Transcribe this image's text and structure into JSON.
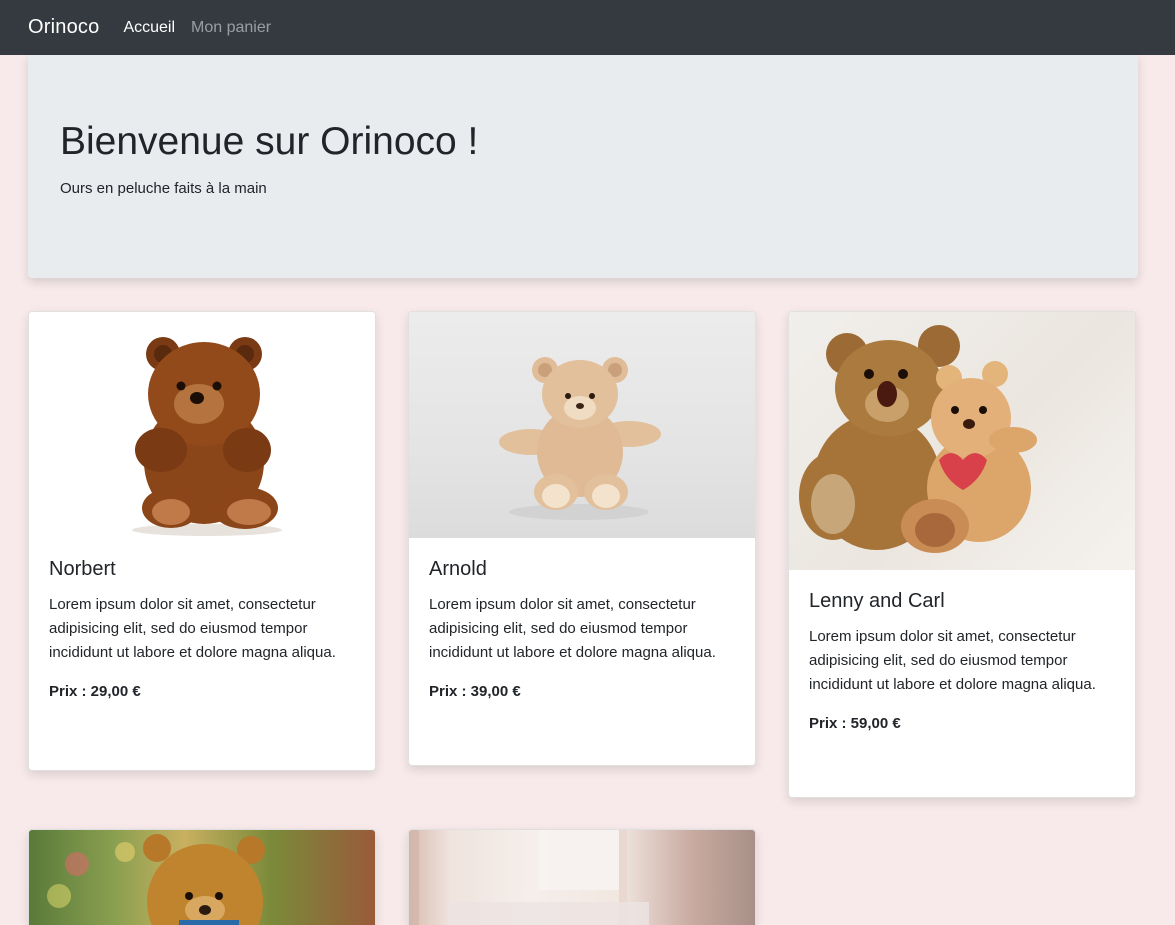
{
  "navbar": {
    "brand": "Orinoco",
    "links": [
      {
        "label": "Accueil"
      },
      {
        "label": "Mon panier"
      }
    ]
  },
  "jumbotron": {
    "title": "Bienvenue sur Orinoco !",
    "subtitle": "Ours en peluche faits à la main"
  },
  "products": [
    {
      "name": "Norbert",
      "description": "Lorem ipsum dolor sit amet, consectetur adipisicing elit, sed do eiusmod tempor incididunt ut labore et dolore magna aliqua.",
      "price": "Prix : 29,00 €"
    },
    {
      "name": "Arnold",
      "description": "Lorem ipsum dolor sit amet, consectetur adipisicing elit, sed do eiusmod tempor incididunt ut labore et dolore magna aliqua.",
      "price": "Prix : 39,00 €"
    },
    {
      "name": "Lenny and Carl",
      "description": "Lorem ipsum dolor sit amet, consectetur adipisicing elit, sed do eiusmod tempor incididunt ut labore et dolore magna aliqua.",
      "price": "Prix : 59,00 €"
    }
  ],
  "colors": {
    "navbar_bg": "#343a40",
    "page_bg": "#f8eaea",
    "jumbotron_bg": "#e9ecef"
  }
}
